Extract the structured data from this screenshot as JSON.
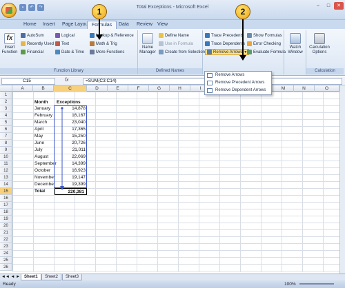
{
  "window": {
    "title": "Total Exceptions - Microsoft Excel"
  },
  "tabs": [
    "Home",
    "Insert",
    "Page Layout",
    "Formulas",
    "Data",
    "Review",
    "View"
  ],
  "ribbon": {
    "insert_function": "Insert Function",
    "function_library": {
      "label": "Function Library",
      "items": [
        "AutoSum",
        "Recently Used",
        "Financial",
        "Logical",
        "Text",
        "Date & Time",
        "Lookup & Reference",
        "Math & Trig",
        "More Functions"
      ]
    },
    "name_manager": "Name Manager",
    "defined_names": {
      "label": "Defined Names",
      "items": [
        "Define Name",
        "Use in Formula",
        "Create from Selection"
      ]
    },
    "formula_auditing": {
      "items": [
        "Trace Precedents",
        "Trace Dependents",
        "Remove Arrows",
        "Show Formulas",
        "Error Checking",
        "Evaluate Formula"
      ]
    },
    "watch_window": "Watch Window",
    "calculation": {
      "label": "Calculation",
      "options": "Calculation Options"
    }
  },
  "menu": [
    "Remove Arrows",
    "Remove Precedent Arrows",
    "Remove Dependent Arrows"
  ],
  "formula_bar": {
    "name_box": "C15",
    "fx": "fx",
    "formula": "=SUM(C3:C14)"
  },
  "columns": [
    "A",
    "B",
    "C",
    "D",
    "E",
    "F",
    "G",
    "H",
    "I",
    "J",
    "K",
    "L",
    "M",
    "N",
    "O"
  ],
  "rows": [
    "1",
    "2",
    "3",
    "4",
    "5",
    "6",
    "7",
    "8",
    "9",
    "10",
    "11",
    "12",
    "13",
    "14",
    "15",
    "16",
    "17",
    "18",
    "19",
    "20",
    "21",
    "22",
    "23",
    "24",
    "25",
    "26"
  ],
  "table": {
    "header_month": "Month",
    "header_exceptions": "Exceptions",
    "months": [
      "January",
      "February",
      "March",
      "April",
      "May",
      "June",
      "July",
      "August",
      "September",
      "October",
      "November",
      "December"
    ],
    "values": [
      "14,878",
      "16,167",
      "23,040",
      "17,365",
      "15,250",
      "20,726",
      "21,011",
      "22,069",
      "14,399",
      "16,923",
      "19,147",
      "19,399"
    ],
    "total_label": "Total",
    "total_value": "220,381"
  },
  "callouts": [
    "1",
    "2"
  ],
  "sheets": [
    "Sheet1",
    "Sheet2",
    "Sheet3"
  ],
  "status": {
    "ready": "Ready",
    "zoom": "100%"
  }
}
